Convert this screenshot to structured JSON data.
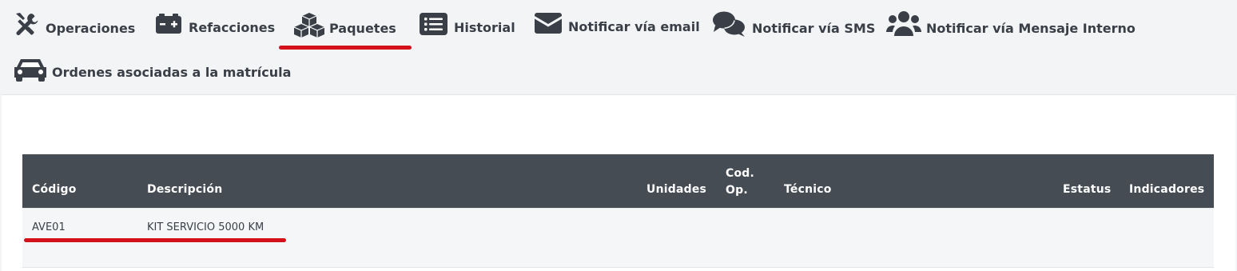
{
  "tabs": {
    "operaciones": "Operaciones",
    "refacciones": "Refacciones",
    "paquetes": "Paquetes",
    "historial": "Historial",
    "email": "Notificar vía email",
    "sms": "Notificar vía SMS",
    "interno": "Notificar vía Mensaje Interno",
    "ordenes": "Ordenes asociadas a la matrícula",
    "active": "paquetes"
  },
  "table": {
    "headers": {
      "codigo": "Código",
      "descripcion": "Descripción",
      "unidades": "Unidades",
      "cod_op_line1": "Cod.",
      "cod_op_line2": "Op.",
      "tecnico": "Técnico",
      "estatus": "Estatus",
      "indicadores": "Indicadores"
    },
    "rows": [
      {
        "codigo": "AVE01",
        "descripcion": "KIT SERVICIO 5000 KM",
        "unidades": "",
        "cod_op": "",
        "tecnico": "",
        "estatus": "",
        "indicadores": ""
      }
    ]
  },
  "colors": {
    "accent": "#d4101b",
    "header_bg": "#464c54",
    "icon": "#3a3f47"
  },
  "icons": {
    "operaciones": "tools-icon",
    "refacciones": "battery-icon",
    "paquetes": "cubes-icon",
    "historial": "list-icon",
    "email": "envelope-icon",
    "sms": "chat-bubbles-icon",
    "interno": "users-icon",
    "ordenes": "car-icon"
  }
}
